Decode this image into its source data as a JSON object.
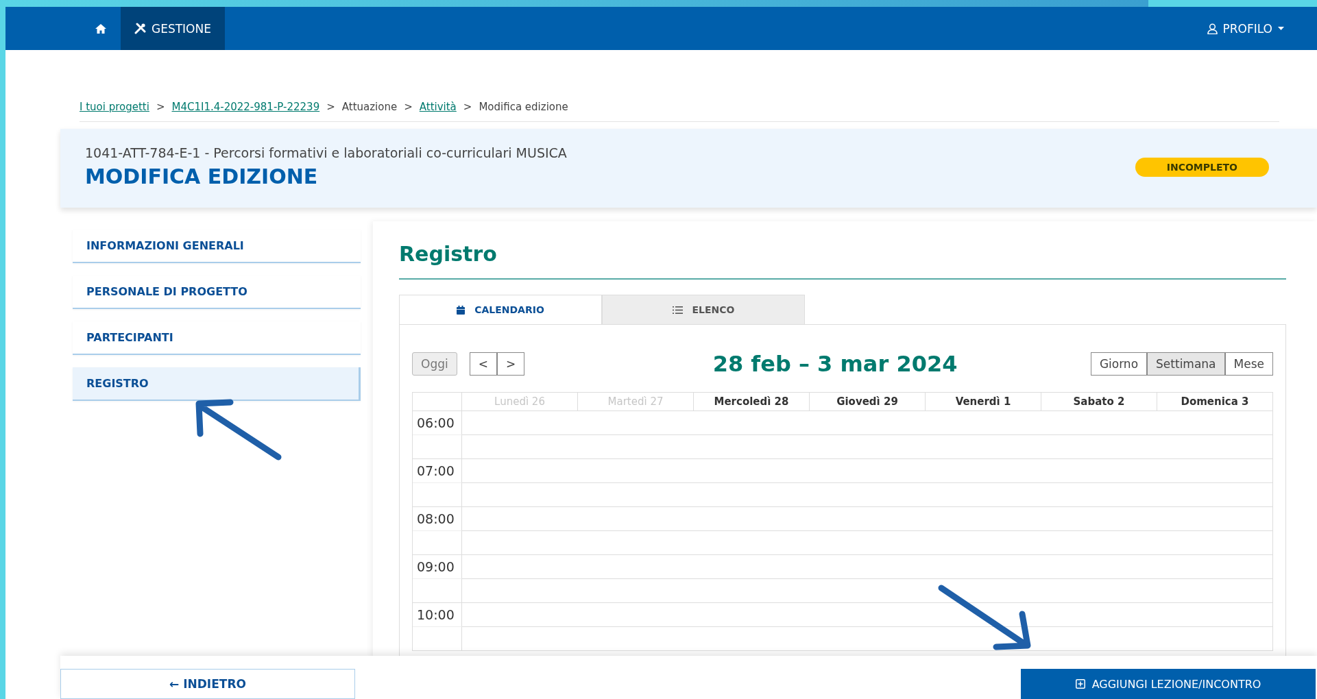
{
  "topbar": {
    "items": [
      {
        "kind": "home",
        "selected": false
      },
      {
        "kind": "tools",
        "label": "GESTIONE",
        "selected": true
      }
    ],
    "profile": "PROFILO"
  },
  "breadcrumb": [
    {
      "label": "I tuoi progetti",
      "link": true
    },
    {
      "label": "M4C1I1.4-2022-981-P-22239",
      "link": true
    },
    {
      "label": "Attuazione",
      "link": false
    },
    {
      "label": "Attività",
      "link": true
    },
    {
      "label": "Modifica edizione",
      "link": false
    }
  ],
  "separator": ">",
  "header": {
    "subtitle": "1041-ATT-784-E-1 - Percorsi formativi e laboratoriali co-curriculari MUSICA",
    "title": "MODIFICA EDIZIONE",
    "status": "INCOMPLETO"
  },
  "sidebar": {
    "items": [
      {
        "label": "INFORMAZIONI GENERALI",
        "selected": false
      },
      {
        "label": "PERSONALE DI PROGETTO",
        "selected": false
      },
      {
        "label": "PARTECIPANTI",
        "selected": false
      },
      {
        "label": "REGISTRO",
        "selected": true
      }
    ]
  },
  "section_title": "Registro",
  "tabs": [
    {
      "kind": "calendar",
      "label": "CALENDARIO",
      "selected": true
    },
    {
      "kind": "list",
      "label": "ELENCO",
      "selected": false
    }
  ],
  "calendar": {
    "today": "Oggi",
    "prev": "<",
    "next": ">",
    "range": "28 feb – 3 mar 2024",
    "views": [
      {
        "label": "Giorno",
        "selected": false
      },
      {
        "label": "Settimana",
        "selected": true
      },
      {
        "label": "Mese",
        "selected": false
      }
    ],
    "days": [
      {
        "label": "Lunedì 26",
        "disabled": true
      },
      {
        "label": "Martedì 27",
        "disabled": true
      },
      {
        "label": "Mercoledì 28",
        "disabled": false
      },
      {
        "label": "Giovedì 29",
        "disabled": false
      },
      {
        "label": "Venerdì 1",
        "disabled": false
      },
      {
        "label": "Sabato 2",
        "disabled": false
      },
      {
        "label": "Domenica 3",
        "disabled": false
      }
    ],
    "hours": [
      "06:00",
      "07:00",
      "08:00",
      "09:00",
      "10:00"
    ]
  },
  "footer": {
    "back": "INDIETRO",
    "back_icon": "←",
    "add": "AGGIUNGI LEZIONE/INCONTRO"
  }
}
